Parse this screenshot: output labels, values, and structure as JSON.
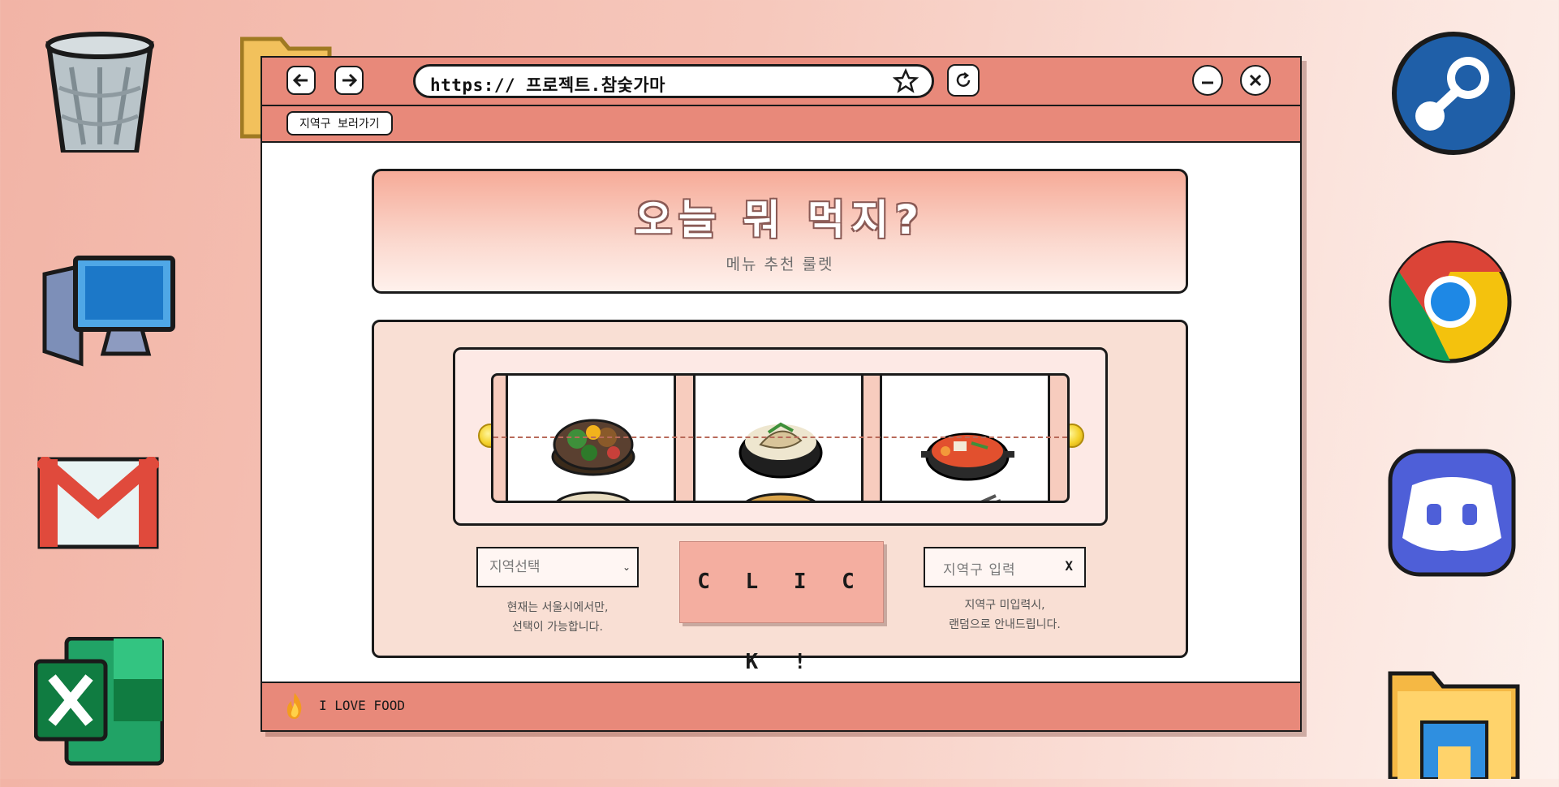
{
  "browser": {
    "url": "https:// 프로젝트.참숯가마",
    "shortcut_button": "지역구 보러가기"
  },
  "header": {
    "title": "오늘 뭐 먹지?",
    "subtitle": "메뉴 추천 룰렛"
  },
  "controls": {
    "region_select": {
      "selected": "지역선택",
      "note_line1": "현재는 서울시에서만,",
      "note_line2": "선택이 가능합니다."
    },
    "spin_button": "C L I C K !",
    "district_input": {
      "placeholder": "지역구 입력",
      "clear_label": "X",
      "note_line1": "지역구 미입력시,",
      "note_line2": "랜덤으로 안내드립니다."
    }
  },
  "footer": {
    "text": "I LOVE FOOD"
  },
  "desktop_icons": [
    "recycle-bin-icon",
    "folder-icon",
    "my-computer-icon",
    "gmail-icon",
    "excel-icon",
    "steam-icon",
    "chrome-icon",
    "discord-icon",
    "file-explorer-icon"
  ],
  "colors": {
    "accent": "#e8897a",
    "button": "#f4aea0",
    "panel": "#f9dfd4",
    "outline": "#1a1a1a"
  }
}
